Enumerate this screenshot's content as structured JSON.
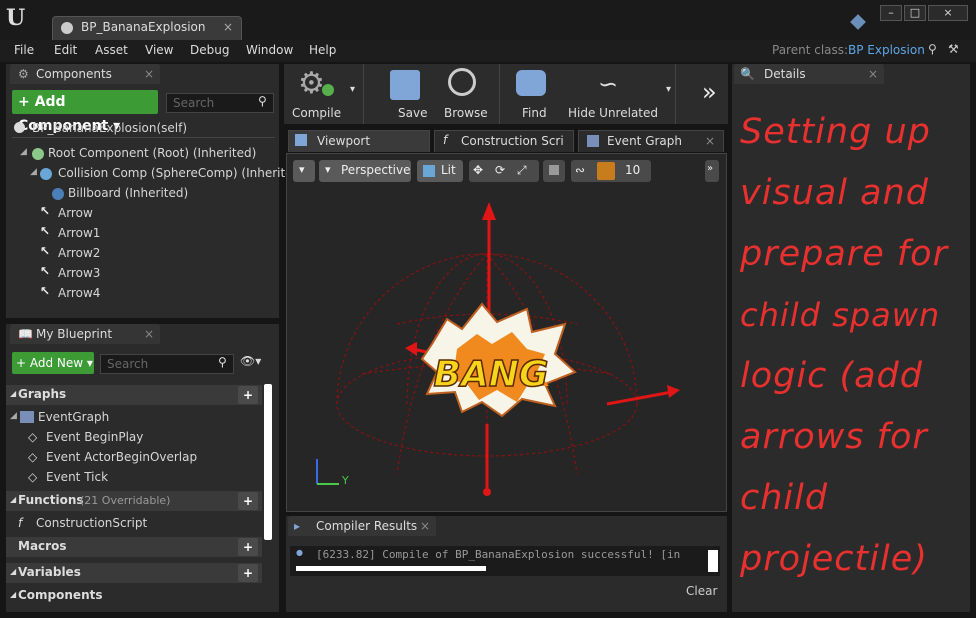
{
  "window": {
    "tab_title": "BP_BananaExplosion",
    "tab_close": "×",
    "buttons": [
      "–",
      "□",
      "×"
    ]
  },
  "menu": [
    "File",
    "Edit",
    "Asset",
    "View",
    "Debug",
    "Window",
    "Help"
  ],
  "parent": {
    "label": "Parent class:",
    "value": "BP Explosion"
  },
  "components_panel": {
    "title": "Components",
    "add_button": "+ Add Component ▾",
    "search_placeholder": "Search",
    "self": "BP_BananaExplosion(self)",
    "items": [
      "Root Component (Root) (Inherited)",
      "Collision Comp (SphereComp) (Inherited)",
      "Billboard (Inherited)",
      "Arrow",
      "Arrow1",
      "Arrow2",
      "Arrow3",
      "Arrow4"
    ]
  },
  "my_blueprint": {
    "title": "My Blueprint",
    "add_button": "+ Add New ▾",
    "search_placeholder": "Search",
    "graphs": "Graphs",
    "event_graph": "EventGraph",
    "events": [
      "Event BeginPlay",
      "Event ActorBeginOverlap",
      "Event Tick"
    ],
    "functions": "Functions",
    "functions_count": "(21 Overridable)",
    "construction": "ConstructionScript",
    "macros": "Macros",
    "variables": "Variables",
    "components": "Components"
  },
  "toolbar": {
    "compile": "Compile",
    "save": "Save",
    "browse": "Browse",
    "find": "Find",
    "hide_unrelated": "Hide Unrelated"
  },
  "editor_tabs": [
    "Viewport",
    "Construction Scri",
    "Event Graph"
  ],
  "viewport": {
    "perspective": "Perspective",
    "lit": "Lit",
    "grid_size": "10",
    "bang_text": "BANG",
    "axis_y": "Y"
  },
  "compiler": {
    "title": "Compiler Results",
    "message": "[6233.82] Compile of BP_BananaExplosion successful! [in",
    "clear": "Clear"
  },
  "details": {
    "title": "Details",
    "note_lines": [
      "Setting up",
      "visual and",
      "prepare for",
      "child spawn",
      "logic (add",
      "arrows for",
      "child",
      "projectile)"
    ]
  },
  "colors": {
    "accent_green": "#3d9b36",
    "link_blue": "#5ea7e8",
    "note_red": "#e8302f"
  }
}
